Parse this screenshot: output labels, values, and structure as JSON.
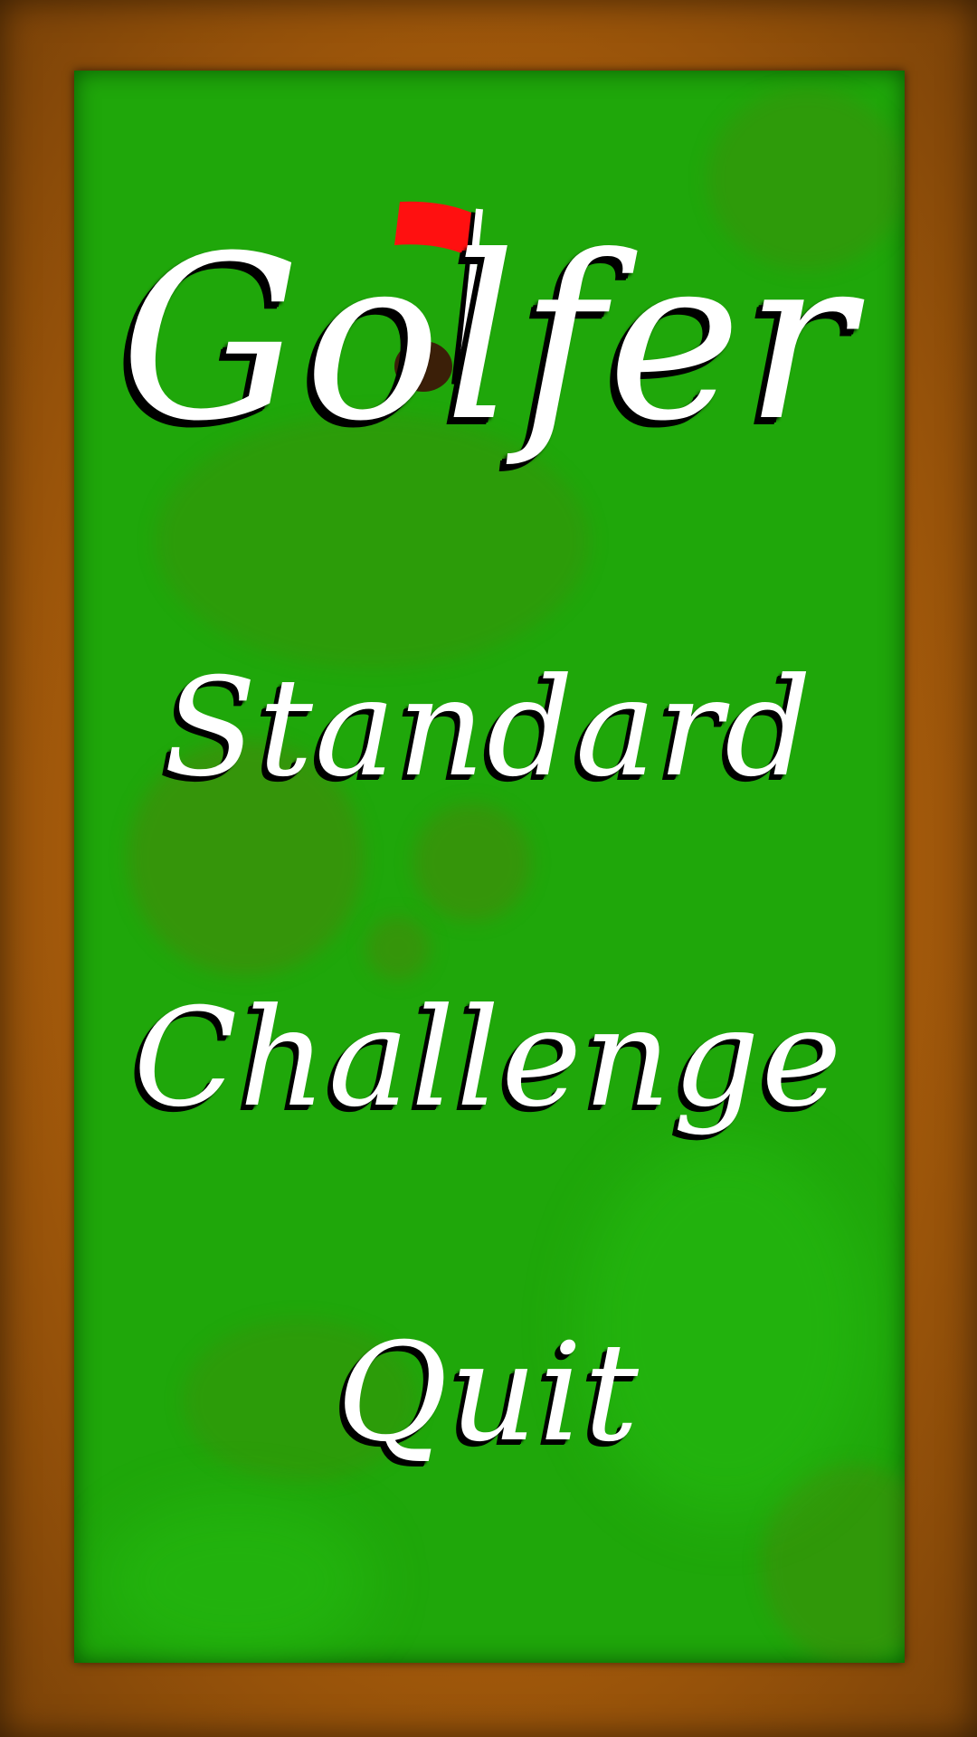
{
  "title": "Golfer",
  "menu": {
    "standard_label": "Standard",
    "challenge_label": "Challenge",
    "quit_label": "Quit"
  },
  "colors": {
    "frame": "#a85d0b",
    "green": "#1fa70a",
    "text": "#ffffff",
    "text_shadow": "#000000",
    "flag": "#ff0000",
    "hole": "#3b1f08"
  },
  "icons": {
    "flag": "flag-icon",
    "hole": "golf-hole-icon"
  }
}
